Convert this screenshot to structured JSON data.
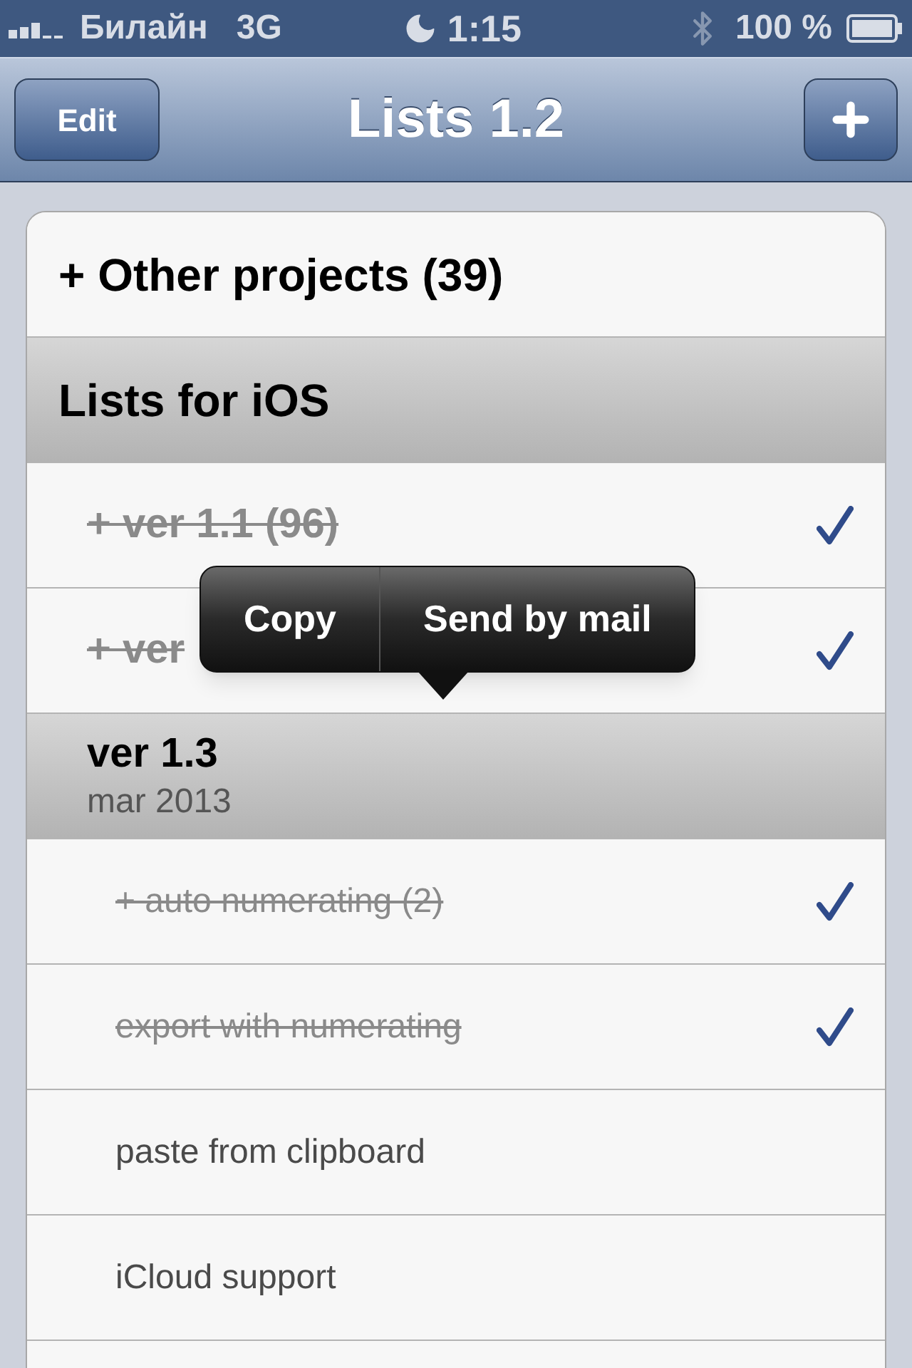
{
  "status_bar": {
    "carrier": "Билайн",
    "network": "3G",
    "time": "1:15",
    "battery": "100 %"
  },
  "nav_bar": {
    "left_button": "Edit",
    "title": "Lists 1.2"
  },
  "lists": [
    {
      "title": "+ Other projects (39)",
      "expanded": false
    },
    {
      "title": "Lists for iOS",
      "expanded": true,
      "children": [
        {
          "title": "+ ver 1.1 (96)",
          "checked": true
        },
        {
          "title": "+ ver",
          "checked": true
        },
        {
          "title": "ver 1.3",
          "subtitle": "mar 2013",
          "expanded": true,
          "children": [
            {
              "title": "+ auto numerating (2)",
              "checked": true
            },
            {
              "title": "export with numerating",
              "checked": true
            },
            {
              "title": "paste from clipboard",
              "checked": false
            },
            {
              "title": "iCloud support",
              "checked": false
            }
          ]
        }
      ]
    }
  ],
  "context_menu": {
    "items": [
      "Copy",
      "Send by mail"
    ]
  }
}
